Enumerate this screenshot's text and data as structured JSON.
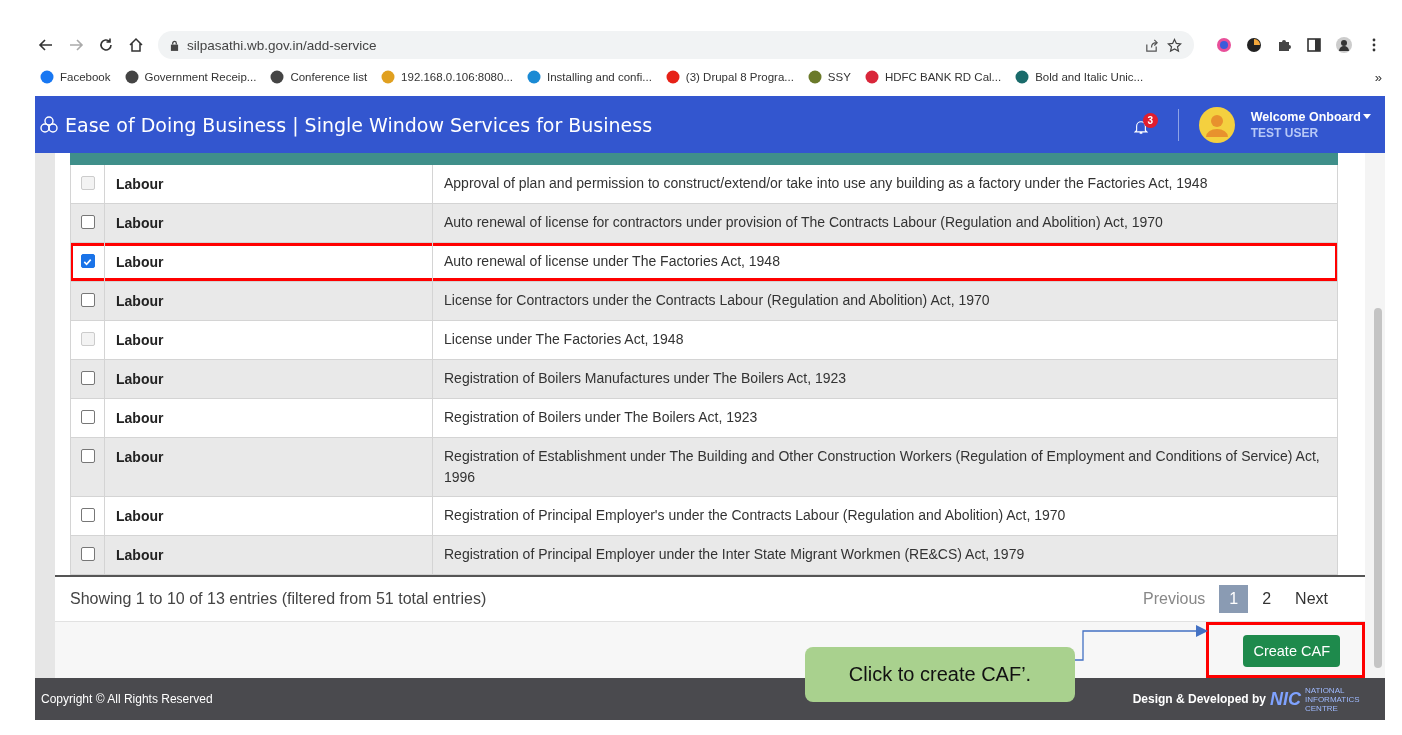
{
  "browser": {
    "url": "silpasathi.wb.gov.in/add-service",
    "bookmarks": [
      {
        "label": "Facebook",
        "color": "#1877f2"
      },
      {
        "label": "Government Receip...",
        "color": "#444444"
      },
      {
        "label": "Conference list",
        "color": "#444444"
      },
      {
        "label": "192.168.0.106:8080...",
        "color": "#e0a020"
      },
      {
        "label": "Installing and confi...",
        "color": "#1a8ad4"
      },
      {
        "label": "(3) Drupal 8 Progra...",
        "color": "#e62117"
      },
      {
        "label": "SSY",
        "color": "#6b7a2a"
      },
      {
        "label": "HDFC BANK RD Cal...",
        "color": "#d9263a"
      },
      {
        "label": "Bold and Italic Unic...",
        "color": "#1a6b6b"
      }
    ],
    "more": "»"
  },
  "header": {
    "title": "Ease of Doing Business | Single Window Services for Business",
    "notifications": "3",
    "welcome": "Welcome Onboard",
    "user": "TEST USER"
  },
  "table": {
    "rows": [
      {
        "checked": false,
        "disabled": true,
        "highlighted": false,
        "category": "Labour",
        "service": "Approval of plan and permission to construct/extend/or take into use any building as a factory under the Factories Act, 1948"
      },
      {
        "checked": false,
        "disabled": false,
        "highlighted": false,
        "category": "Labour",
        "service": "Auto renewal of license for contractors under provision of The Contracts Labour (Regulation and Abolition) Act, 1970"
      },
      {
        "checked": true,
        "disabled": false,
        "highlighted": true,
        "category": "Labour",
        "service": "Auto renewal of license under The Factories Act, 1948"
      },
      {
        "checked": false,
        "disabled": false,
        "highlighted": false,
        "category": "Labour",
        "service": "License for Contractors under the Contracts Labour (Regulation and Abolition) Act, 1970"
      },
      {
        "checked": false,
        "disabled": true,
        "highlighted": false,
        "category": "Labour",
        "service": "License under The Factories Act, 1948"
      },
      {
        "checked": false,
        "disabled": false,
        "highlighted": false,
        "category": "Labour",
        "service": "Registration of Boilers Manufactures under The Boilers Act, 1923"
      },
      {
        "checked": false,
        "disabled": false,
        "highlighted": false,
        "category": "Labour",
        "service": "Registration of Boilers under The Boilers Act, 1923"
      },
      {
        "checked": false,
        "disabled": false,
        "highlighted": false,
        "category": "Labour",
        "service": "Registration of Establishment under The Building and Other Construction Workers (Regulation of Employment and Conditions of Service) Act, 1996"
      },
      {
        "checked": false,
        "disabled": false,
        "highlighted": false,
        "category": "Labour",
        "service": "Registration of Principal Employer's under the Contracts Labour (Regulation and Abolition) Act, 1970"
      },
      {
        "checked": false,
        "disabled": false,
        "highlighted": false,
        "category": "Labour",
        "service": "Registration of Principal Employer under the Inter State Migrant Workmen (RE&CS) Act, 1979"
      }
    ],
    "info": "Showing 1 to 10 of 13 entries (filtered from 51 total entries)",
    "pagination": {
      "previous": "Previous",
      "pages": [
        {
          "label": "1",
          "selected": true
        },
        {
          "label": "2",
          "selected": false
        }
      ],
      "next": "Next"
    }
  },
  "create_button": {
    "label": "Create CAF",
    "highlighted": true
  },
  "callout": "Click to create CAF’.",
  "footer": {
    "copyright": "Copyright © All Rights Reserved",
    "credit": "Design & Developed by",
    "logo": "NIC",
    "logo_sub": "NATIONAL INFORMATICS CENTRE"
  }
}
